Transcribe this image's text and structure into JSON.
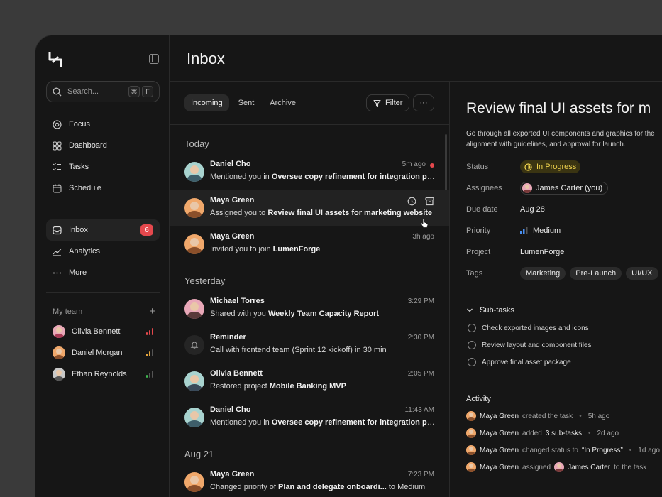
{
  "sidebar": {
    "search_placeholder": "Search...",
    "search_kbd": [
      "⌘",
      "F"
    ],
    "nav_top": [
      {
        "label": "Focus",
        "icon": "focus-icon"
      },
      {
        "label": "Dashboard",
        "icon": "dashboard-icon"
      },
      {
        "label": "Tasks",
        "icon": "tasks-icon"
      },
      {
        "label": "Schedule",
        "icon": "calendar-icon"
      }
    ],
    "nav_bottom": [
      {
        "label": "Inbox",
        "icon": "inbox-icon",
        "badge": "6",
        "active": true
      },
      {
        "label": "Analytics",
        "icon": "analytics-icon"
      },
      {
        "label": "More",
        "icon": "more-icon"
      }
    ],
    "team_title": "My team",
    "team": [
      {
        "name": "Olivia Bennett",
        "bar_color": "#e5484d"
      },
      {
        "name": "Daniel Morgan",
        "bar_color": "#e5a53d"
      },
      {
        "name": "Ethan Reynolds",
        "bar_color": "#3fb950"
      }
    ]
  },
  "header": {
    "title": "Inbox"
  },
  "list": {
    "tabs": [
      "Incoming",
      "Sent",
      "Archive"
    ],
    "filter_label": "Filter",
    "more_label": "···",
    "groups": {
      "today": "Today",
      "yesterday": "Yesterday",
      "aug21": "Aug 21"
    },
    "messages": [
      {
        "name": "Daniel Cho",
        "pre": "Mentioned you in ",
        "bold": "Oversee copy refinement for integration pages",
        "post": "",
        "time": "5m ago",
        "unread": true
      },
      {
        "name": "Maya Green",
        "pre": "Assigned you to ",
        "bold": "Review final UI assets for marketing website",
        "post": "",
        "time": ""
      },
      {
        "name": "Maya Green",
        "pre": "Invited you to join ",
        "bold": "LumenForge",
        "post": "",
        "time": "3h ago"
      },
      {
        "name": "Michael Torres",
        "pre": "Shared with you ",
        "bold": "Weekly Team Capacity Report",
        "post": "",
        "time": "3:29 PM"
      },
      {
        "name": "Reminder",
        "pre": "Call with frontend team (Sprint 12 kickoff) in 30 min",
        "bold": "",
        "post": "",
        "time": "2:30 PM"
      },
      {
        "name": "Olivia Bennett",
        "pre": "Restored project ",
        "bold": "Mobile Banking MVP",
        "post": "",
        "time": "2:05 PM"
      },
      {
        "name": "Daniel Cho",
        "pre": "Mentioned you in ",
        "bold": "Oversee copy refinement for integration pages",
        "post": "",
        "time": "11:43 AM"
      },
      {
        "name": "Maya Green",
        "pre": "Changed priority of ",
        "bold": "Plan and delegate onboardi...",
        "post": " to Medium",
        "time": "7:23 PM"
      }
    ]
  },
  "detail": {
    "title": "Review final UI assets for m",
    "desc_1": "Go through all exported UI components and graphics for the",
    "desc_2": "alignment with guidelines, and approval for launch.",
    "labels": {
      "status": "Status",
      "assignees": "Assignees",
      "due": "Due date",
      "priority": "Priority",
      "project": "Project",
      "tags": "Tags"
    },
    "status": "In Progress",
    "assignee": "James Carter (you)",
    "due": "Aug 28",
    "priority": "Medium",
    "project": "LumenForge",
    "tags": [
      "Marketing",
      "Pre-Launch",
      "UI/UX"
    ],
    "subtasks_title": "Sub-tasks",
    "subtasks": [
      "Check exported images and icons",
      "Review layout and component files",
      "Approve final asset package"
    ],
    "activity_title": "Activity",
    "activity": [
      {
        "who": "Maya Green",
        "action": "created the task",
        "extra": "",
        "when": "5h ago"
      },
      {
        "who": "Maya Green",
        "action": "added",
        "extra": "3 sub-tasks",
        "when": "2d ago"
      },
      {
        "who": "Maya Green",
        "action": "changed status to",
        "extra": "“In Progress”",
        "when": "1d ago"
      },
      {
        "who": "Maya Green",
        "action": "assigned",
        "extra": "James Carter",
        "tail": "to the task",
        "when": ""
      }
    ]
  },
  "colors": {
    "accent_red": "#e5484d",
    "status_yellow": "#f0d34e",
    "bg": "#161616"
  }
}
